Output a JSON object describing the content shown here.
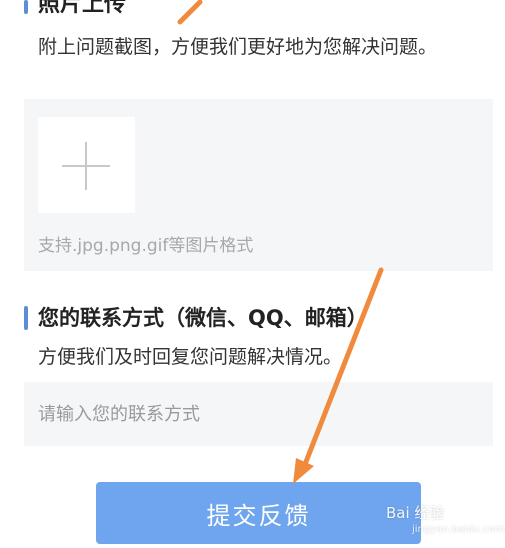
{
  "screenshot_section": {
    "title": "照片上传",
    "hint": "附上问题截图，方便我们更好地为您解决问题。",
    "format_note": "支持.jpg.png.gif等图片格式"
  },
  "contact_section": {
    "title": "您的联系方式（微信、QQ、邮箱）",
    "hint": "方便我们及时回复您问题解决情况。",
    "placeholder": "请输入您的联系方式"
  },
  "submit": {
    "label": "提交反馈"
  },
  "watermark": {
    "brand": "Bai 经验",
    "url": "jingyan.baidu.com"
  },
  "colors": {
    "accent": "#5a8fd6",
    "button": "#6fa5ee",
    "arrow": "#f08a3c",
    "panel": "#f5f6f8"
  },
  "icons": {
    "add": "plus-icon",
    "annotation": "arrow-icon"
  }
}
